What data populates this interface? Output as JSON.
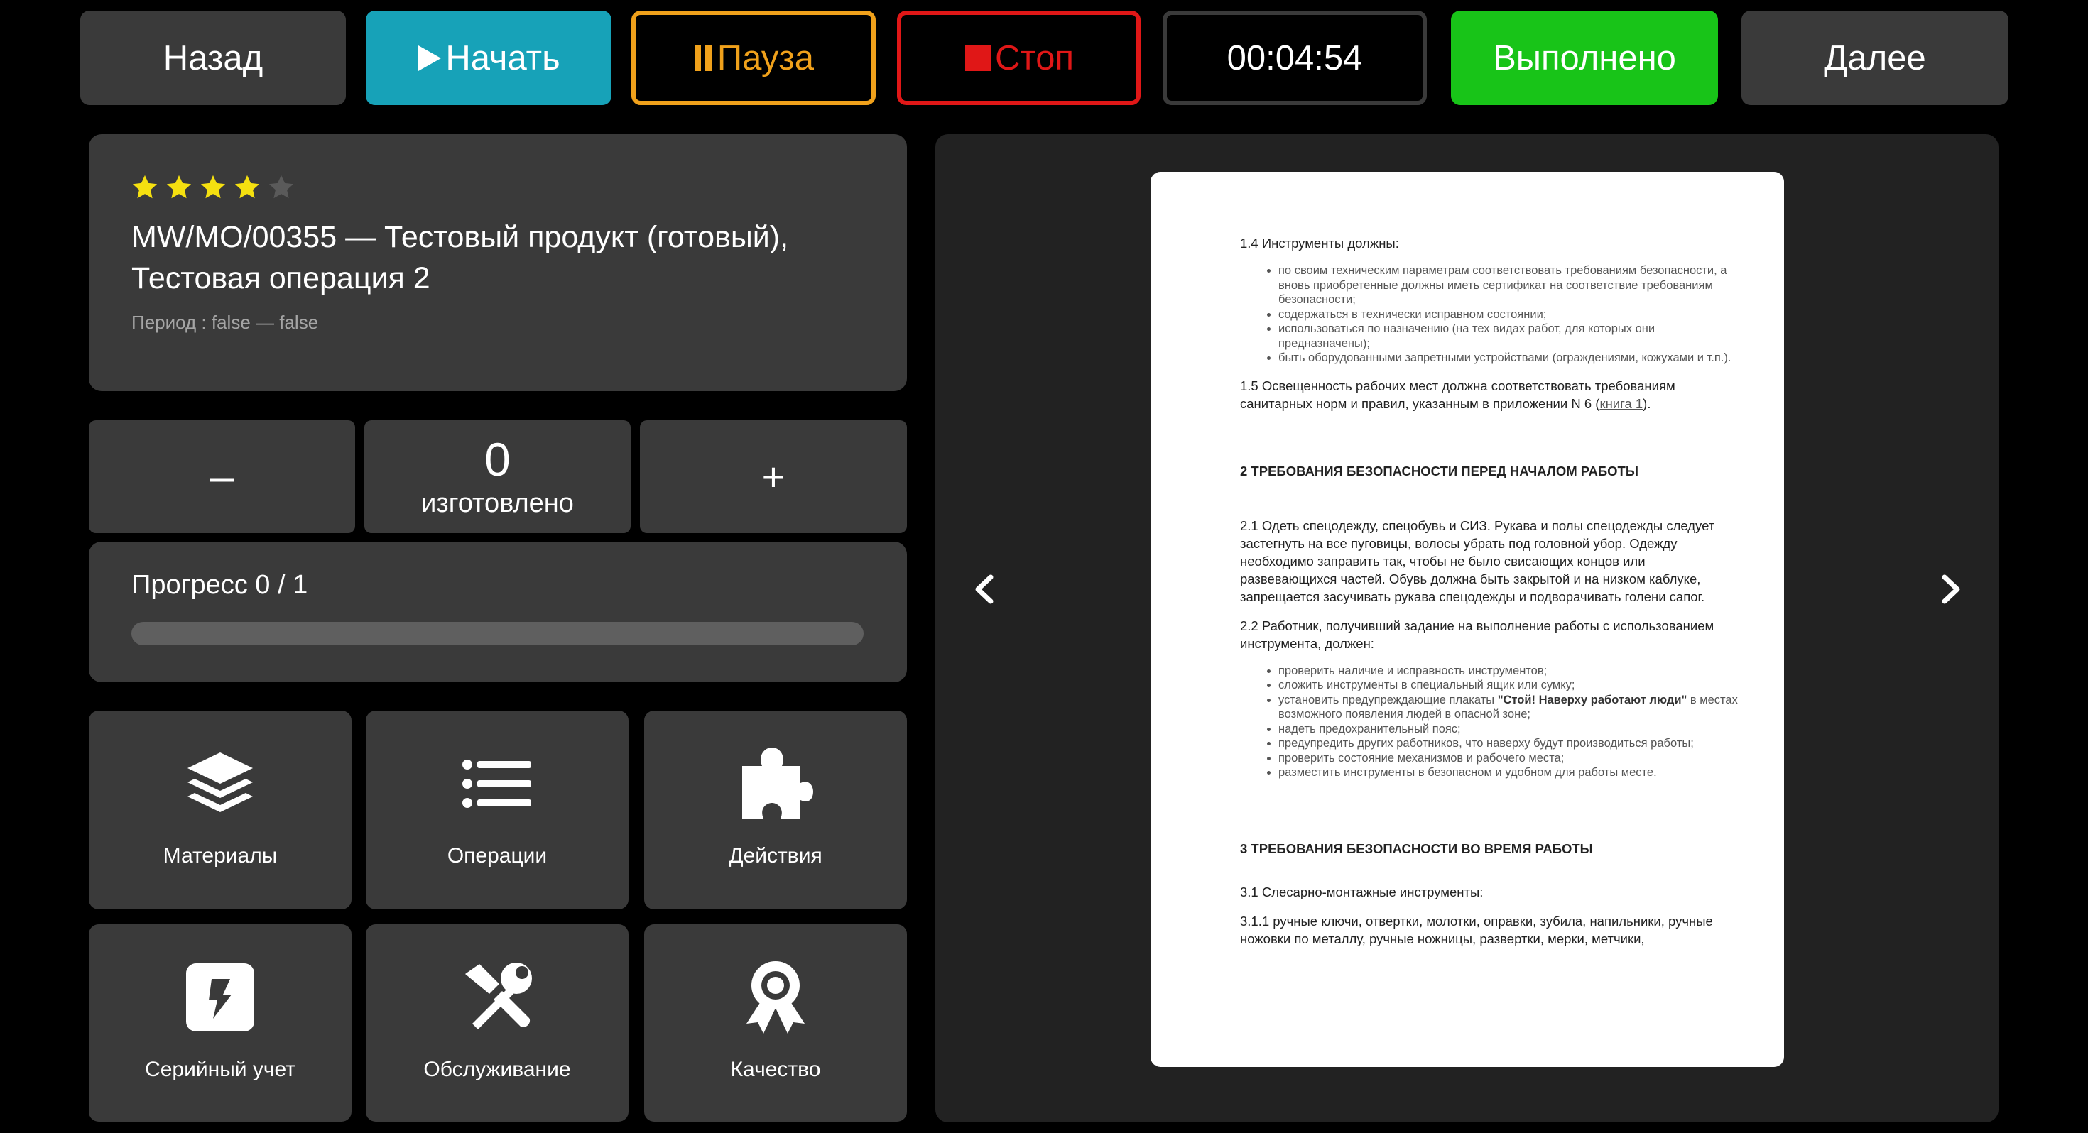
{
  "toolbar": {
    "back_label": "Назад",
    "start_label": "Начать",
    "pause_label": "Пауза",
    "stop_label": "Стоп",
    "timer": "00:04:54",
    "done_label": "Выполнено",
    "next_label": "Далее"
  },
  "colors": {
    "start": "#17a2b8",
    "pause": "#f0a11b",
    "stop": "#e01717",
    "done": "#18c418",
    "star_on": "#f5e010",
    "star_off": "#5a5a5a"
  },
  "order": {
    "rating": 4,
    "rating_max": 5,
    "title_line1": "MW/MO/00355 — Тестовый продукт (готовый),",
    "title_line2": "Тестовая операция 2",
    "period": "Период : false — false"
  },
  "counter": {
    "minus": "–",
    "value": "0",
    "label": "изготовлено",
    "plus": "+"
  },
  "progress": {
    "text": "Прогресс 0 / 1",
    "done": 0,
    "total": 1
  },
  "tiles": [
    {
      "label": "Материалы",
      "icon": "layers-icon"
    },
    {
      "label": "Операции",
      "icon": "list-icon"
    },
    {
      "label": "Действия",
      "icon": "puzzle-icon"
    },
    {
      "label": "Серийный учет",
      "icon": "bolt-icon"
    },
    {
      "label": "Обслуживание",
      "icon": "tools-icon"
    },
    {
      "label": "Качество",
      "icon": "award-icon"
    }
  ],
  "document": {
    "s14_title": "1.4 Инструменты должны:",
    "s14_items": [
      "по своим техническим параметрам соответствовать требованиям безопасности, а вновь приобретенные должны иметь сертификат на соответствие требованиям безопасности;",
      "содержаться в технически исправном состоянии;",
      "использоваться по назначению (на тех видах работ, для которых они предназначены);",
      "быть оборудованными запретными устройствами (ограждениями, кожухами и т.п.)."
    ],
    "s15_text": "1.5 Освещенность рабочих мест должна соответствовать требованиям санитарных норм и правил, указанным в приложении N 6 (",
    "s15_link": "книга 1",
    "s15_end": ").",
    "h2": "2 ТРЕБОВАНИЯ БЕЗОПАСНОСТИ ПЕРЕД НАЧАЛОМ РАБОТЫ",
    "s21": "2.1 Одеть спецодежду, спецобувь и СИЗ. Рукава и полы спецодежды следует застегнуть на все пуговицы, волосы убрать под головной убор. Одежду необходимо заправить так, чтобы не было свисающих концов или развевающихся частей. Обувь должна быть закрытой и на низком каблуке, запрещается засучивать рукава спецодежды и подворачивать голени сапог.",
    "s22": "2.2 Работник, получивший задание на выполнение работы с использованием инструмента, должен:",
    "s22_item_1": "проверить наличие и исправность инструментов;",
    "s22_item_2": "сложить инструменты в специальный ящик или сумку;",
    "s22_item_3_pre": "установить предупреждающие плакаты ",
    "s22_item_3_bold": "\"Стой! Наверху работают люди\"",
    "s22_item_3_post": " в местах возможного появления людей в опасной зоне;",
    "s22_item_4": "надеть предохранительный пояс;",
    "s22_item_5": "предупредить других работников, что наверху будут производиться работы;",
    "s22_item_6": "проверить состояние механизмов и рабочего места;",
    "s22_item_7": "разместить инструменты в безопасном и удобном для работы месте.",
    "h3": "3 ТРЕБОВАНИЯ БЕЗОПАСНОСТИ ВО ВРЕМЯ РАБОТЫ",
    "s31": "3.1 Слесарно-монтажные инструменты:",
    "s311": "3.1.1 ручные ключи, отвертки, молотки, оправки, зубила, напильники, ручные ножовки по металлу, ручные ножницы, развертки, мерки, метчики,"
  }
}
